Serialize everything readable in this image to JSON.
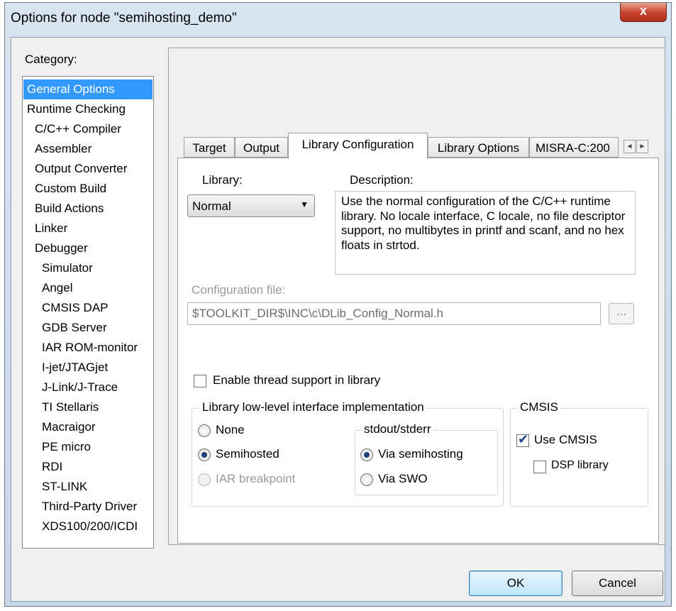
{
  "window": {
    "title": "Options for node \"semihosting_demo\"",
    "close_label": "x"
  },
  "category": {
    "label": "Category:",
    "items": [
      {
        "label": "General Options",
        "level": 0,
        "selected": true
      },
      {
        "label": "Runtime Checking",
        "level": 0
      },
      {
        "label": "C/C++ Compiler",
        "level": 1
      },
      {
        "label": "Assembler",
        "level": 1
      },
      {
        "label": "Output Converter",
        "level": 1
      },
      {
        "label": "Custom Build",
        "level": 1
      },
      {
        "label": "Build Actions",
        "level": 1
      },
      {
        "label": "Linker",
        "level": 1
      },
      {
        "label": "Debugger",
        "level": 1
      },
      {
        "label": "Simulator",
        "level": 2
      },
      {
        "label": "Angel",
        "level": 2
      },
      {
        "label": "CMSIS DAP",
        "level": 2
      },
      {
        "label": "GDB Server",
        "level": 2
      },
      {
        "label": "IAR ROM-monitor",
        "level": 2
      },
      {
        "label": "I-jet/JTAGjet",
        "level": 2
      },
      {
        "label": "J-Link/J-Trace",
        "level": 2
      },
      {
        "label": "TI Stellaris",
        "level": 2
      },
      {
        "label": "Macraigor",
        "level": 2
      },
      {
        "label": "PE micro",
        "level": 2
      },
      {
        "label": "RDI",
        "level": 2
      },
      {
        "label": "ST-LINK",
        "level": 2
      },
      {
        "label": "Third-Party Driver",
        "level": 2
      },
      {
        "label": "XDS100/200/ICDI",
        "level": 2
      }
    ]
  },
  "tabs": {
    "items": [
      {
        "label": "Target"
      },
      {
        "label": "Output"
      },
      {
        "label": "Library Configuration",
        "active": true
      },
      {
        "label": "Library Options"
      },
      {
        "label": "MISRA-C:200"
      }
    ],
    "scroll_left": "◄",
    "scroll_right": "►"
  },
  "library": {
    "label": "Library:",
    "value": "Normal",
    "description_label": "Description:",
    "description": "Use the normal configuration of the C/C++ runtime library. No locale interface, C locale, no file descriptor support, no multibytes in printf and scanf, and no hex floats in strtod."
  },
  "config_file": {
    "label": "Configuration file:",
    "value": "$TOOLKIT_DIR$\\INC\\c\\DLib_Config_Normal.h",
    "browse_label": "..."
  },
  "thread_support": {
    "label": "Enable thread support in library",
    "checked": false
  },
  "low_level": {
    "title": "Library low-level interface implementation",
    "options": [
      {
        "label": "None",
        "selected": false,
        "disabled": false
      },
      {
        "label": "Semihosted",
        "selected": true,
        "disabled": false
      },
      {
        "label": "IAR breakpoint",
        "selected": false,
        "disabled": true
      }
    ],
    "stdout": {
      "title": "stdout/stderr",
      "options": [
        {
          "label": "Via semihosting",
          "selected": true
        },
        {
          "label": "Via SWO",
          "selected": false
        }
      ]
    }
  },
  "cmsis": {
    "title": "CMSIS",
    "use_cmsis": {
      "label": "Use CMSIS",
      "checked": true
    },
    "dsp_library": {
      "label": "DSP library",
      "checked": false
    }
  },
  "buttons": {
    "ok": "OK",
    "cancel": "Cancel"
  },
  "colors": {
    "selection": "#3399ff",
    "close_button": "#c8412c",
    "ok_highlight": "#bee6fd"
  }
}
